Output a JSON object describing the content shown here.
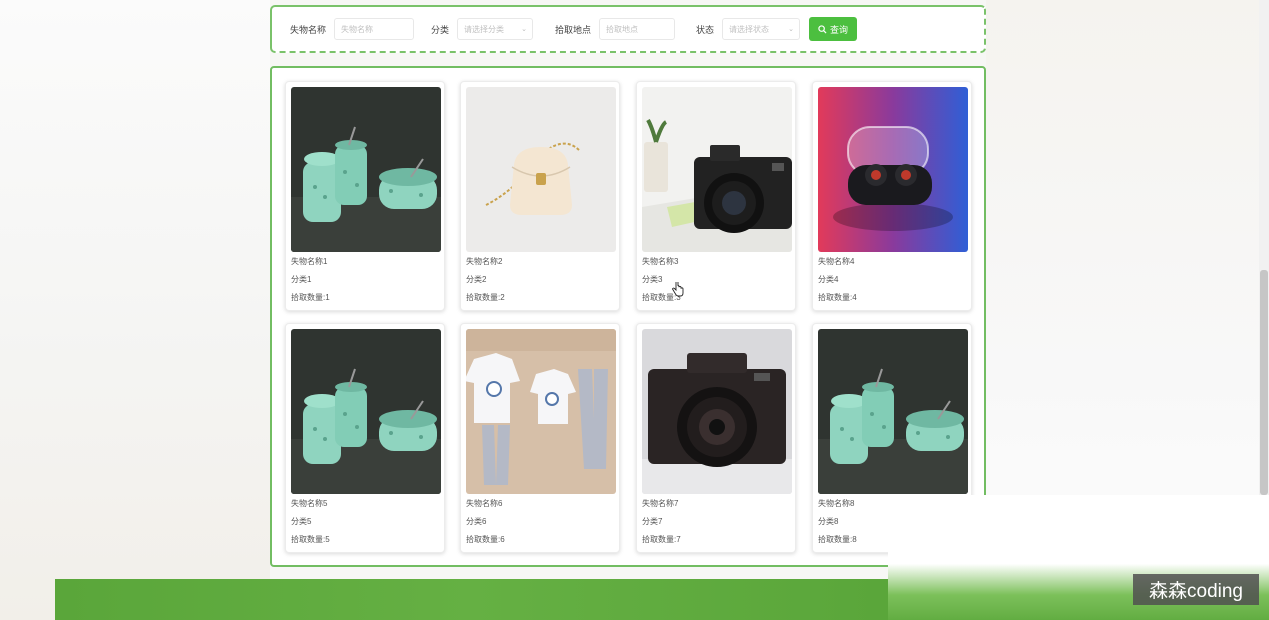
{
  "search": {
    "fields": [
      {
        "label": "失物名称",
        "placeholder": "失物名称"
      },
      {
        "label": "分类",
        "placeholder": "请选择分类"
      },
      {
        "label": "拾取地点",
        "placeholder": "拾取地点"
      },
      {
        "label": "状态",
        "placeholder": "请选择状态"
      }
    ],
    "button_label": "查询",
    "button_icon": "search-icon"
  },
  "items": [
    {
      "name": "失物名称1",
      "category": "分类1",
      "count": "拾取数量:1",
      "image": "teapot-set"
    },
    {
      "name": "失物名称2",
      "category": "分类2",
      "count": "拾取数量:2",
      "image": "handbag"
    },
    {
      "name": "失物名称3",
      "category": "分类3",
      "count": "拾取数量:3",
      "image": "camera-desk"
    },
    {
      "name": "失物名称4",
      "category": "分类4",
      "count": "拾取数量:4",
      "image": "earbuds"
    },
    {
      "name": "失物名称5",
      "category": "分类5",
      "count": "拾取数量:5",
      "image": "teapot-set"
    },
    {
      "name": "失物名称6",
      "category": "分类6",
      "count": "拾取数量:6",
      "image": "clothes"
    },
    {
      "name": "失物名称7",
      "category": "分类7",
      "count": "拾取数量:7",
      "image": "camera"
    },
    {
      "name": "失物名称8",
      "category": "分类8",
      "count": "拾取数量:8",
      "image": "teapot-set"
    }
  ],
  "watermark": "森森coding",
  "colors": {
    "accent": "#4cbf3f",
    "border": "#72bd62",
    "footer": "#5aa63a"
  }
}
